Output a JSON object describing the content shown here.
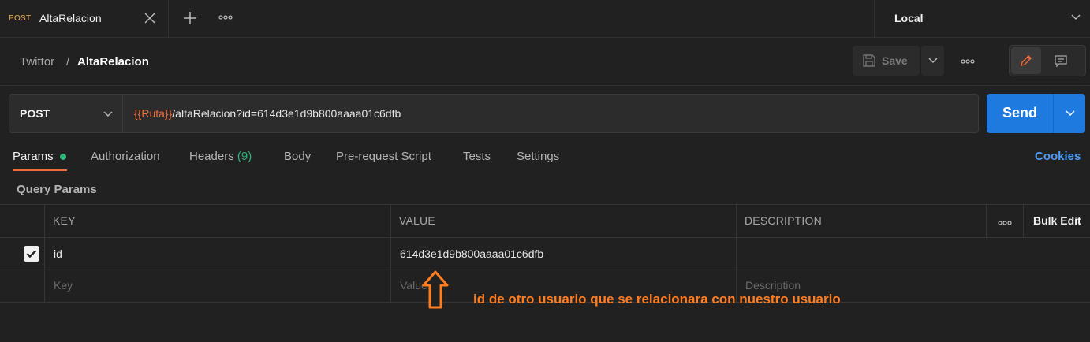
{
  "tab": {
    "method": "POST",
    "title": "AltaRelacion"
  },
  "environment": {
    "selected": "Local"
  },
  "breadcrumb": {
    "parent": "Twittor",
    "separator": "/",
    "current": "AltaRelacion"
  },
  "toolbar": {
    "save_label": "Save"
  },
  "request": {
    "method": "POST",
    "url_variable": "{{Ruta}}",
    "url_rest": "/altaRelacion?id=614d3e1d9b800aaaa01c6dfb",
    "send_label": "Send"
  },
  "request_tabs": {
    "params": "Params",
    "authorization": "Authorization",
    "headers": "Headers",
    "headers_count": "(9)",
    "body": "Body",
    "prerequest": "Pre-request Script",
    "tests": "Tests",
    "settings": "Settings",
    "cookies": "Cookies"
  },
  "query_params": {
    "title": "Query Params",
    "headers": {
      "key": "KEY",
      "value": "VALUE",
      "description": "DESCRIPTION",
      "bulk_edit": "Bulk Edit"
    },
    "rows": [
      {
        "checked": true,
        "key": "id",
        "value": "614d3e1d9b800aaaa01c6dfb",
        "description": ""
      }
    ],
    "placeholders": {
      "key": "Key",
      "value": "Value",
      "description": "Description"
    }
  },
  "annotation": {
    "text": "id de otro usuario que se relacionara con nuestro usuario"
  },
  "colors": {
    "background": "#212121",
    "accent_orange": "#f26b3a",
    "send_blue": "#1f7ae0",
    "status_green": "#2fb37a",
    "annotation_orange": "#ff7c1f",
    "link_blue": "#4d9cf5"
  },
  "icons": {
    "tab_close": "close-icon",
    "new_tab": "plus-icon",
    "more": "ellipsis-icon",
    "save": "save-icon",
    "edit": "pencil-icon",
    "comment": "comment-icon",
    "dropdown": "chevron-down-icon",
    "checkbox": "checkbox-checked-icon",
    "arrow": "arrow-up-icon"
  }
}
